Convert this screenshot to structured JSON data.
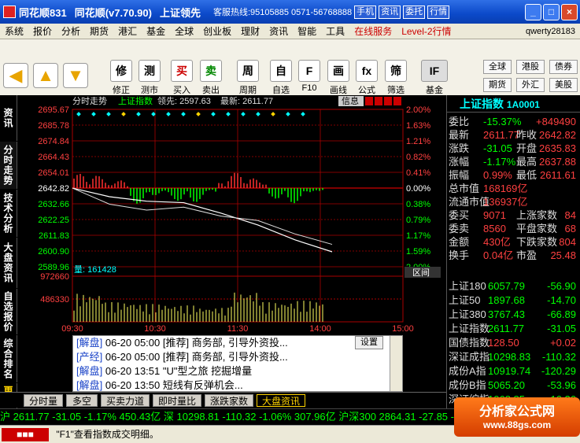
{
  "window": {
    "app": "同花顺831",
    "version": "同花顺(v7.70.90)",
    "slogan": "上证领先",
    "hotline": "客服热线:95105885 0571-56768888",
    "tbtn": [
      "手机",
      "资讯",
      "委托",
      "行情"
    ],
    "ctl": [
      "_",
      "□",
      "×"
    ]
  },
  "menu": [
    "系统",
    "报价",
    "分析",
    "期货",
    "港汇",
    "基金",
    "全球",
    "创业板",
    "理财",
    "资讯",
    "智能",
    "工具"
  ],
  "menu_red": [
    "在线服务",
    "Level-2行情"
  ],
  "user": "qwerty28183",
  "toolbar": [
    {
      "label": "修正",
      "icon": "修"
    },
    {
      "label": "测市",
      "icon": "测"
    },
    {
      "label": "买入",
      "icon": "买"
    },
    {
      "label": "卖出",
      "icon": "卖"
    },
    {
      "label": "周期",
      "icon": "周"
    },
    {
      "label": "自选",
      "icon": "自"
    },
    {
      "label": "F10",
      "icon": "F"
    },
    {
      "label": "画线",
      "icon": "画"
    },
    {
      "label": "公式",
      "icon": "fx"
    },
    {
      "label": "筛选",
      "icon": "筛"
    },
    {
      "label": "基金",
      "icon": "IF"
    }
  ],
  "right_buttons": [
    "全球",
    "港股",
    "债券",
    "期货",
    "外汇",
    "美股"
  ],
  "side_tabs": [
    "资讯",
    "分时走势",
    "技术分析",
    "大盘资讯",
    "自选报价",
    "综合排名",
    "更多"
  ],
  "chart": {
    "header_title": "分时走势",
    "index_name": "上证指数",
    "lead_label": "领先: 2597.63",
    "latest_label": "最新: 2611.77",
    "info_btn": "信息",
    "price_ticks": [
      "2695.67",
      "2685.78",
      "2674.84",
      "2664.43",
      "2654.01",
      "2642.82",
      "2632.66",
      "2622.25",
      "2611.83",
      "2600.90",
      "2589.96"
    ],
    "pct_ticks": [
      "2.00%",
      "1.63%",
      "1.21%",
      "0.82%",
      "0.41%",
      "0.00%",
      "0.38%",
      "0.79%",
      "1.17%",
      "1.59%",
      "2.00%"
    ],
    "vol_label": "量: 161428",
    "vol_ticks": [
      "972660",
      "486330"
    ],
    "range_btn": "区间",
    "time_ticks": [
      "09:30",
      "10:30",
      "11:30",
      "14:00",
      "15:00"
    ]
  },
  "chart_data": {
    "type": "line",
    "x": [
      "09:30",
      "10:00",
      "10:30",
      "11:00",
      "11:30",
      "13:00",
      "13:30",
      "14:00"
    ],
    "series": [
      {
        "name": "最新",
        "values": [
          2642.8,
          2637,
          2634,
          2633,
          2626,
          2618,
          2608,
          2600
        ]
      },
      {
        "name": "领先",
        "values": [
          2642.8,
          2632,
          2628,
          2630,
          2624,
          2621,
          2612,
          2605
        ]
      }
    ],
    "ylim": [
      2589.96,
      2695.67
    ],
    "volume": [
      600000,
      420000,
      380000,
      350000,
      300000,
      640000,
      420000,
      450000
    ]
  },
  "rpanel": {
    "title": "上证指数",
    "code": "1A0001",
    "rows": [
      {
        "k": "委比",
        "v": "-15.37%",
        "v2": "+849490"
      },
      {
        "k": "最新",
        "v": "2611.77",
        "v2k": "昨收",
        "v2": "2642.82"
      },
      {
        "k": "涨跌",
        "v": "-31.05",
        "v2k": "开盘",
        "v2": "2635.83"
      },
      {
        "k": "涨幅",
        "v": "-1.17%",
        "v2k": "最高",
        "v2": "2637.88"
      },
      {
        "k": "振幅",
        "v": "0.99%",
        "v2k": "最低",
        "v2": "2611.61"
      },
      {
        "k": "总市值",
        "v": "168169亿"
      },
      {
        "k": "流通市值",
        "v": "136937亿"
      },
      {
        "k": "委买",
        "v": "9071",
        "v2k": "上涨家数",
        "v2": "84"
      },
      {
        "k": "委卖",
        "v": "8560",
        "v2k": "平盘家数",
        "v2": "68"
      },
      {
        "k": "金额",
        "v": "430亿",
        "v2k": "下跌家数",
        "v2": "804"
      },
      {
        "k": "换手",
        "v": "0.04亿",
        "v2k": "市盈",
        "v2": "25.48"
      }
    ],
    "indices": [
      {
        "k": "上证180",
        "v": "6057.79",
        "c": "-56.90"
      },
      {
        "k": "上证50",
        "v": "1897.68",
        "c": "-14.70"
      },
      {
        "k": "上证380",
        "v": "3767.43",
        "c": "-66.89"
      },
      {
        "k": "上证指数",
        "v": "2611.77",
        "c": "-31.05"
      },
      {
        "k": "国债指数",
        "v": "128.50",
        "c": "+0.02"
      },
      {
        "k": "深证成指",
        "v": "10298.83",
        "c": "-110.32"
      },
      {
        "k": "成份A指",
        "v": "10919.74",
        "c": "-120.29"
      },
      {
        "k": "成份B指",
        "v": "5065.20",
        "c": "-53.96"
      },
      {
        "k": "深证综指",
        "v": "1068.85",
        "c": "-16.26"
      }
    ]
  },
  "news": {
    "set_btn": "设置",
    "items": [
      {
        "tag": "[解盘]",
        "time": "06-20 05:00",
        "text": "[推荐] 商务部, 引导外资投..."
      },
      {
        "tag": "[产经]",
        "time": "06-20 05:00",
        "text": "[推荐] 商务部, 引导外资投..."
      },
      {
        "tag": "[解盘]",
        "time": "06-20 13:51",
        "text": "\"U\"型之旅  挖掘增量"
      },
      {
        "tag": "[解盘]",
        "time": "06-20 13:50",
        "text": "短线有反弹机会..."
      }
    ]
  },
  "bottom_tabs": [
    "分时量",
    "多空",
    "买卖力道",
    "即时量比",
    "涨跌家数",
    "大盘资讯"
  ],
  "ticker": "沪 2611.77 -31.05 -1.17% 450.43亿 深 10298.81 -110.32 -1.06% 307.96亿 沪深300 2864.31 -27.85 -0.96% 262.37",
  "status": "\"F1\"查看指数成交明细。",
  "watermark": {
    "t1": "分析家公式网",
    "t2": "www.88gs.com"
  }
}
